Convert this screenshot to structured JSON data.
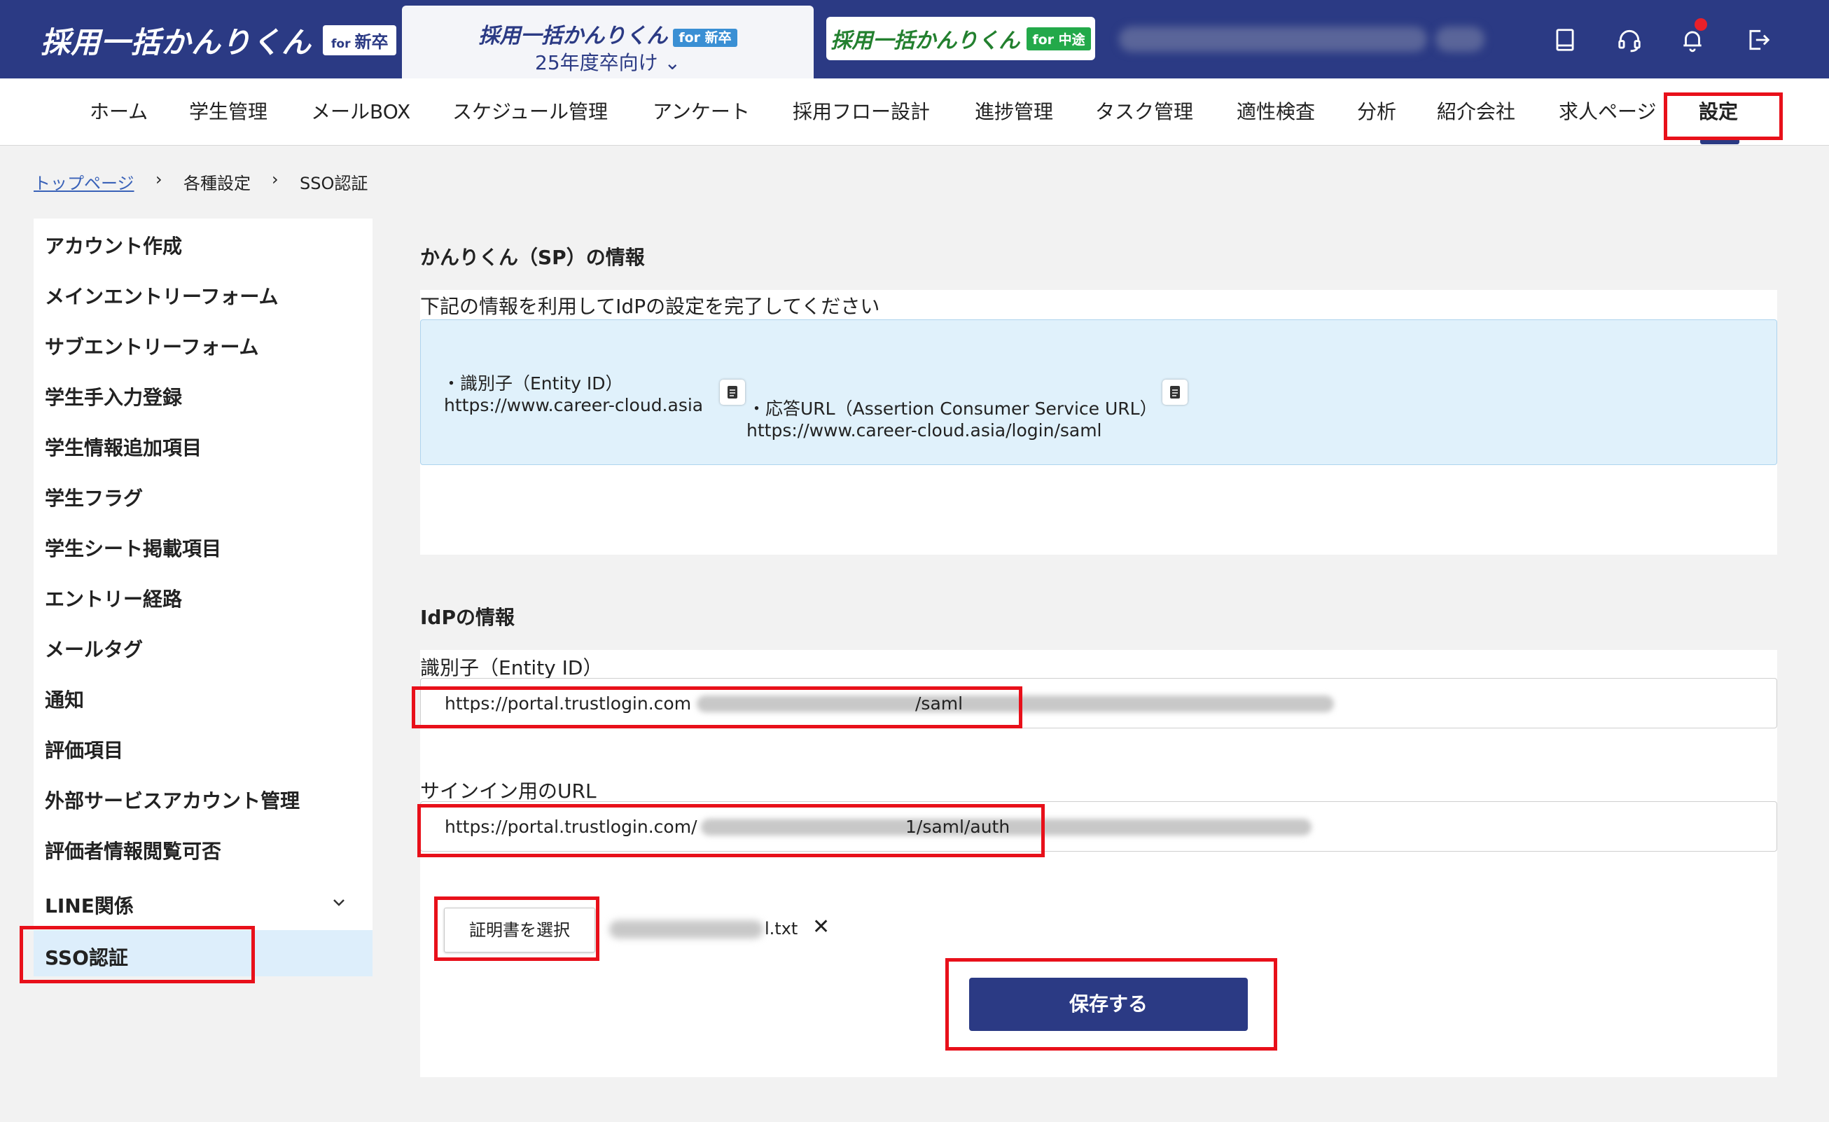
{
  "header": {
    "logo_text": "採用一括かんりくん",
    "logo_badge_small": "for",
    "logo_badge": "新卒",
    "active_tab": {
      "title": "採用一括かんりくん",
      "badge": "for 新卒",
      "subtitle": "25年度卒向け ⌄"
    },
    "other_tab": {
      "title": "採用一括かんりくん",
      "badge": "for 中途"
    },
    "icons": [
      "book-icon",
      "headset-icon",
      "bell-icon",
      "logout-icon"
    ]
  },
  "nav": {
    "items": [
      "ホーム",
      "学生管理",
      "メールBOX",
      "スケジュール管理",
      "アンケート",
      "採用フロー設計",
      "進捗管理",
      "タスク管理",
      "適性検査",
      "分析",
      "紹介会社",
      "求人ページ",
      "設定"
    ],
    "active": "設定"
  },
  "breadcrumb": {
    "top": "トップページ",
    "sep1": "›",
    "settings": "各種設定",
    "sep2": "›",
    "current": "SSO認証"
  },
  "sidebar": {
    "items": [
      "アカウント作成",
      "メインエントリーフォーム",
      "サブエントリーフォーム",
      "学生手入力登録",
      "学生情報追加項目",
      "学生フラグ",
      "学生シート掲載項目",
      "エントリー経路",
      "メールタグ",
      "通知",
      "評価項目",
      "外部サービスアカウント管理",
      "評価者情報閲覧可否",
      "LINE関係",
      "SSO認証"
    ],
    "active": "SSO認証"
  },
  "sp": {
    "title": "かんりくん（SP）の情報",
    "description": "下記の情報を利用してIdPの設定を完了してください",
    "entity_label": "・識別子（Entity ID）",
    "entity_value": "https://www.career-cloud.asia",
    "acs_label": "・応答URL（Assertion Consumer Service URL）",
    "acs_value": "https://www.career-cloud.asia/login/saml"
  },
  "idp": {
    "title": "IdPの情報",
    "entity_label": "識別子（Entity ID）",
    "entity_prefix": "https://portal.trustlogin.com",
    "entity_suffix": "/saml",
    "signin_label": "サインイン用のURL",
    "signin_prefix": "https://portal.trustlogin.com/",
    "signin_suffix": "1/saml/auth",
    "file_button": "証明書を選択",
    "file_name_suffix": "l.txt",
    "file_remove": "✕",
    "save_button": "保存する"
  },
  "colors": {
    "brand": "#2b3a84",
    "highlight": "#e8101a",
    "info_box": "#e0f1fb",
    "active_side": "#ddeefb",
    "notification": "#e8202a"
  }
}
